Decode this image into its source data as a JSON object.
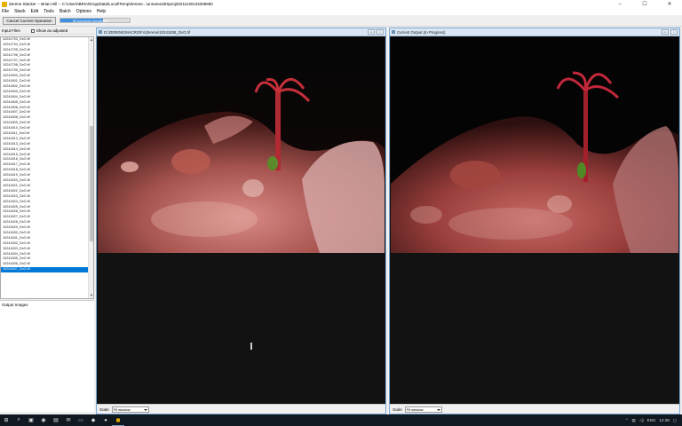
{
  "window": {
    "title": "Zerene Stacker -- Brian Hill -- C:\\Users\\BRIAN\\AppData\\Local\\Temp\\Zerene...\\unnamedZSproj20211130123208680",
    "minimize": "–",
    "maximize": "☐",
    "close": "✕"
  },
  "menu": [
    "File",
    "Stack",
    "Edit",
    "Tools",
    "Batch",
    "Options",
    "Help"
  ],
  "toolbar": {
    "cancel_label": "Cancel Current Operation",
    "progress_text": "80 seconds remaining",
    "progress_fraction": 0.62
  },
  "left_panel": {
    "input_files_label": "Input Files",
    "show_adjusted_label": "Show as adjusted",
    "files": [
      "10241793_DxO.tif",
      "10241794_DxO.tif",
      "10241795_DxO.tif",
      "10241796_DxO.tif",
      "10241797_DxO.tif",
      "10241798_DxO.tif",
      "10241799_DxO.tif",
      "10241800_DxO.tif",
      "10241801_DxO.tif",
      "10241802_DxO.tif",
      "10241803_DxO.tif",
      "10241804_DxO.tif",
      "10241805_DxO.tif",
      "10241806_DxO.tif",
      "10241807_DxO.tif",
      "10241808_DxO.tif",
      "10241809_DxO.tif",
      "10241810_DxO.tif",
      "10241811_DxO.tif",
      "10241812_DxO.tif",
      "10241813_DxO.tif",
      "10241814_DxO.tif",
      "10241815_DxO.tif",
      "10241816_DxO.tif",
      "10241817_DxO.tif",
      "10241818_DxO.tif",
      "10241819_DxO.tif",
      "10241820_DxO.tif",
      "10241821_DxO.tif",
      "10241822_DxO.tif",
      "10241823_DxO.tif",
      "10241824_DxO.tif",
      "10241825_DxO.tif",
      "10241826_DxO.tif",
      "10241827_DxO.tif",
      "10241828_DxO.tif",
      "10241829_DxO.tif",
      "10241830_DxO.tif",
      "10241831_DxO.tif",
      "10241832_DxO.tif",
      "10241833_DxO.tif",
      "10241834_DxO.tif",
      "10241835_DxO.tif",
      "10241836_DxO.tif",
      "10241837_DxO.tif"
    ],
    "selected_index": 44,
    "output_images_label": "Output Images"
  },
  "left_view": {
    "title": "D:\\ZERENE\\MACRO\\Fo\\Zerene\\10241838_DxO.tif",
    "scale_label": "Scale",
    "scale_value": "Fit window"
  },
  "right_view": {
    "title": "Current Output (In Progress)",
    "scale_label": "Scale",
    "scale_value": "Fit window"
  },
  "taskbar": {
    "icons": [
      "windows-start-icon",
      "search-icon",
      "task-view-icon",
      "edge-browser-icon",
      "store-icon",
      "mail-icon",
      "explorer-icon",
      "app-icon-1",
      "app-icon-2",
      "zerene-icon"
    ],
    "lang": "ENG",
    "time": "12:38"
  },
  "colors": {
    "accent": "#0078d7",
    "progress": "#3d8fe0"
  }
}
